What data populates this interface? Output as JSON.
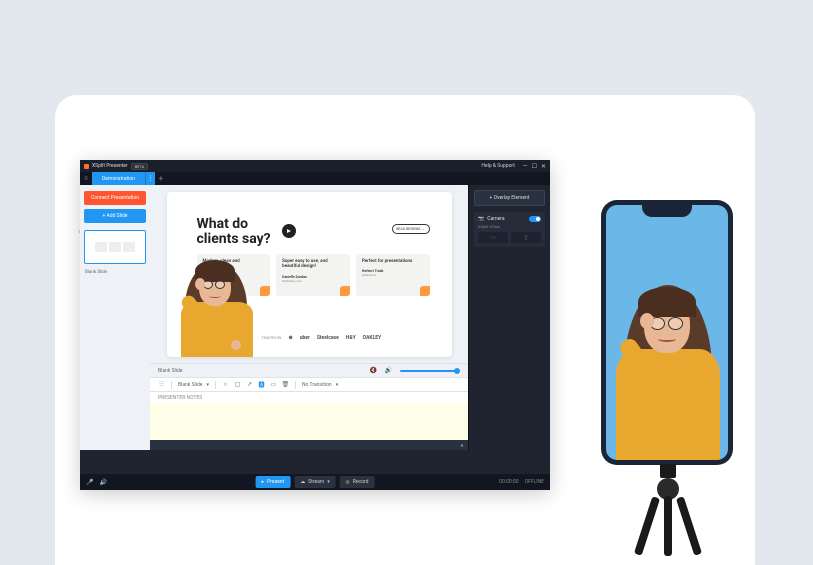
{
  "app": {
    "title": "XSplit Presenter",
    "beta": "BETA",
    "help": "Help & Support"
  },
  "tabs": {
    "active": "Demonstration"
  },
  "sidebar": {
    "connect": "Connect Presentation",
    "addslide": "+  Add Slide",
    "thumb_label": "Blank Slide",
    "thumb_num": "1"
  },
  "slide": {
    "title_l1": "What do",
    "title_l2": "clients say?",
    "reviews_btn": "READ REVIEWS →",
    "testimonials": [
      {
        "quote": "Modern, clean and",
        "author": "",
        "company": ""
      },
      {
        "quote": "Super easy to use, and beautiful design!",
        "author": "Danielle Dunbar",
        "company": "MyStudio.com"
      },
      {
        "quote": "Perfect for presentations",
        "author": "Herbert Trask",
        "company": "webmax.io"
      }
    ],
    "trusted_label": "TRUSTED BY",
    "brands": [
      "uber",
      "Steelcase",
      "H&Y",
      "OAKLEY"
    ]
  },
  "controls": {
    "slide_label": "Blank Slide",
    "layout_dropdown": "Blank Slide",
    "transition": "No Transition",
    "notes_header": "PRESENTER NOTES"
  },
  "rightpanel": {
    "overlay": "+ Overlay Element",
    "camera_title": "Camera",
    "camera_sub": "XSplit VCam"
  },
  "bottombar": {
    "present": "Present",
    "stream": "Stream",
    "record": "Record",
    "time": "00:00:00",
    "status": "OFFLINE"
  }
}
